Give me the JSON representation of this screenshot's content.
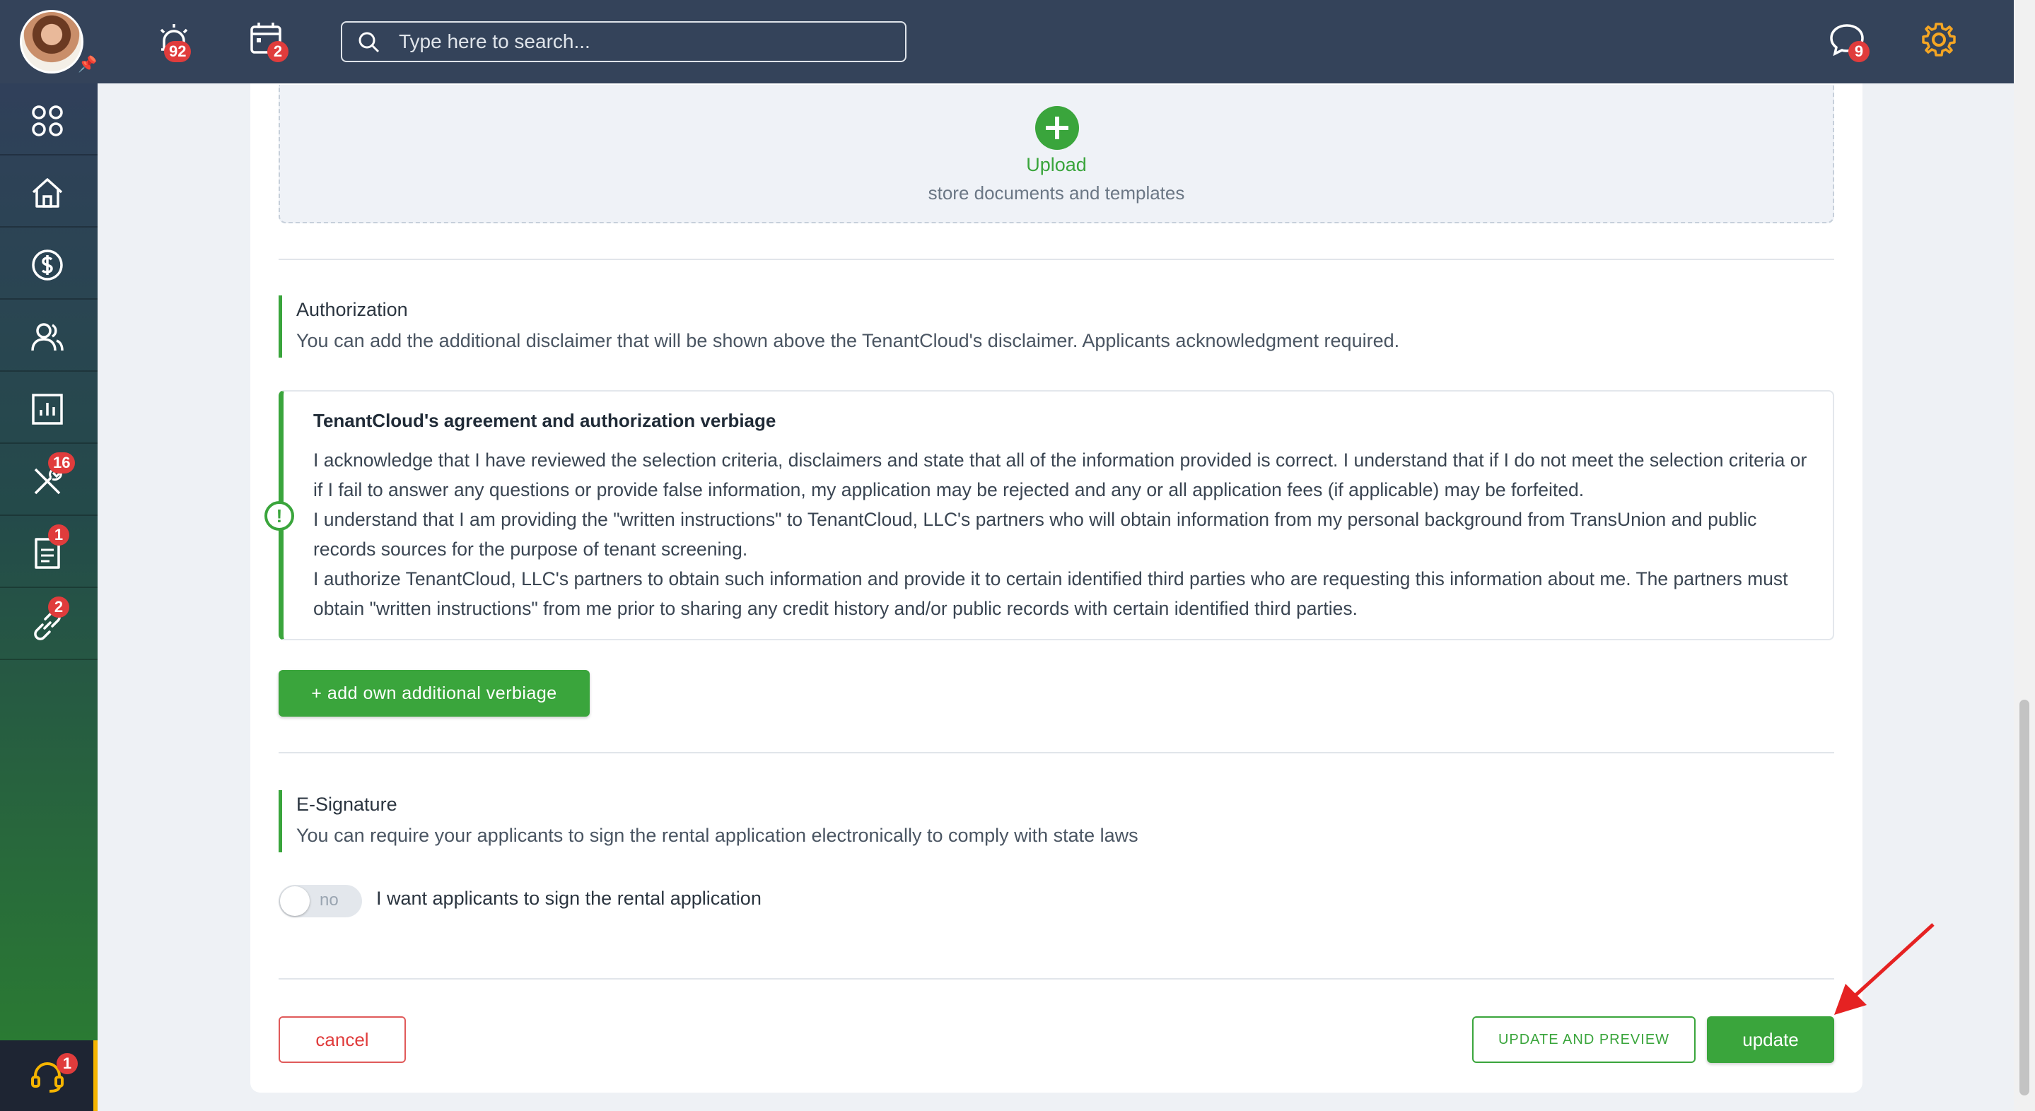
{
  "topbar": {
    "search_placeholder": "Type here to search...",
    "alerts_badge": "92",
    "calendar_badge": "2",
    "messages_badge": "9"
  },
  "sidebar": {
    "items": [
      {
        "icon": "apps-grid-icon",
        "badge": ""
      },
      {
        "icon": "home-icon",
        "badge": ""
      },
      {
        "icon": "dollar-icon",
        "badge": ""
      },
      {
        "icon": "people-icon",
        "badge": ""
      },
      {
        "icon": "reports-icon",
        "badge": ""
      },
      {
        "icon": "maintenance-tools-icon",
        "badge": "16"
      },
      {
        "icon": "documents-icon",
        "badge": "1"
      },
      {
        "icon": "link-icon",
        "badge": "2"
      }
    ],
    "support_badge": "1"
  },
  "upload": {
    "title": "Upload",
    "subtitle": "store documents and templates"
  },
  "authorization": {
    "title": "Authorization",
    "description": "You can add the additional disclaimer that will be shown above the TenantCloud's disclaimer. Applicants acknowledgment required."
  },
  "verbiage": {
    "title": "TenantCloud's agreement and authorization verbiage",
    "paragraphs": [
      "I acknowledge that I have reviewed the selection criteria, disclaimers and state that all of the information provided is correct. I understand that if I do not meet the selection criteria or if I fail to answer any questions or provide false information, my application may be rejected and any or all application fees (if applicable) may be forfeited.",
      "I understand that I am providing the \"written instructions\" to TenantCloud, LLC's partners who will obtain information from my personal background from TransUnion and public records sources for the purpose of tenant screening.",
      "I authorize TenantCloud, LLC's partners to obtain such information and provide it to certain identified third parties who are requesting this information about me. The partners must obtain \"written instructions\" from me prior to sharing any credit history and/or public records with certain identified third parties."
    ]
  },
  "add_button_label": "+ add own additional verbiage",
  "esignature": {
    "title": "E-Signature",
    "description": "You can require your applicants to sign the rental application electronically to comply with state laws",
    "toggle_state": "no",
    "toggle_label": "I want applicants to sign the rental application"
  },
  "actions": {
    "cancel": "cancel",
    "update_and_preview": "UPDATE AND PREVIEW",
    "update": "update"
  },
  "colors": {
    "topbar": "#34435a",
    "accent_green": "#3aa53c",
    "danger_red": "#e03c3c",
    "settings_orange": "#f5a623",
    "annotation_arrow": "#e52222"
  }
}
